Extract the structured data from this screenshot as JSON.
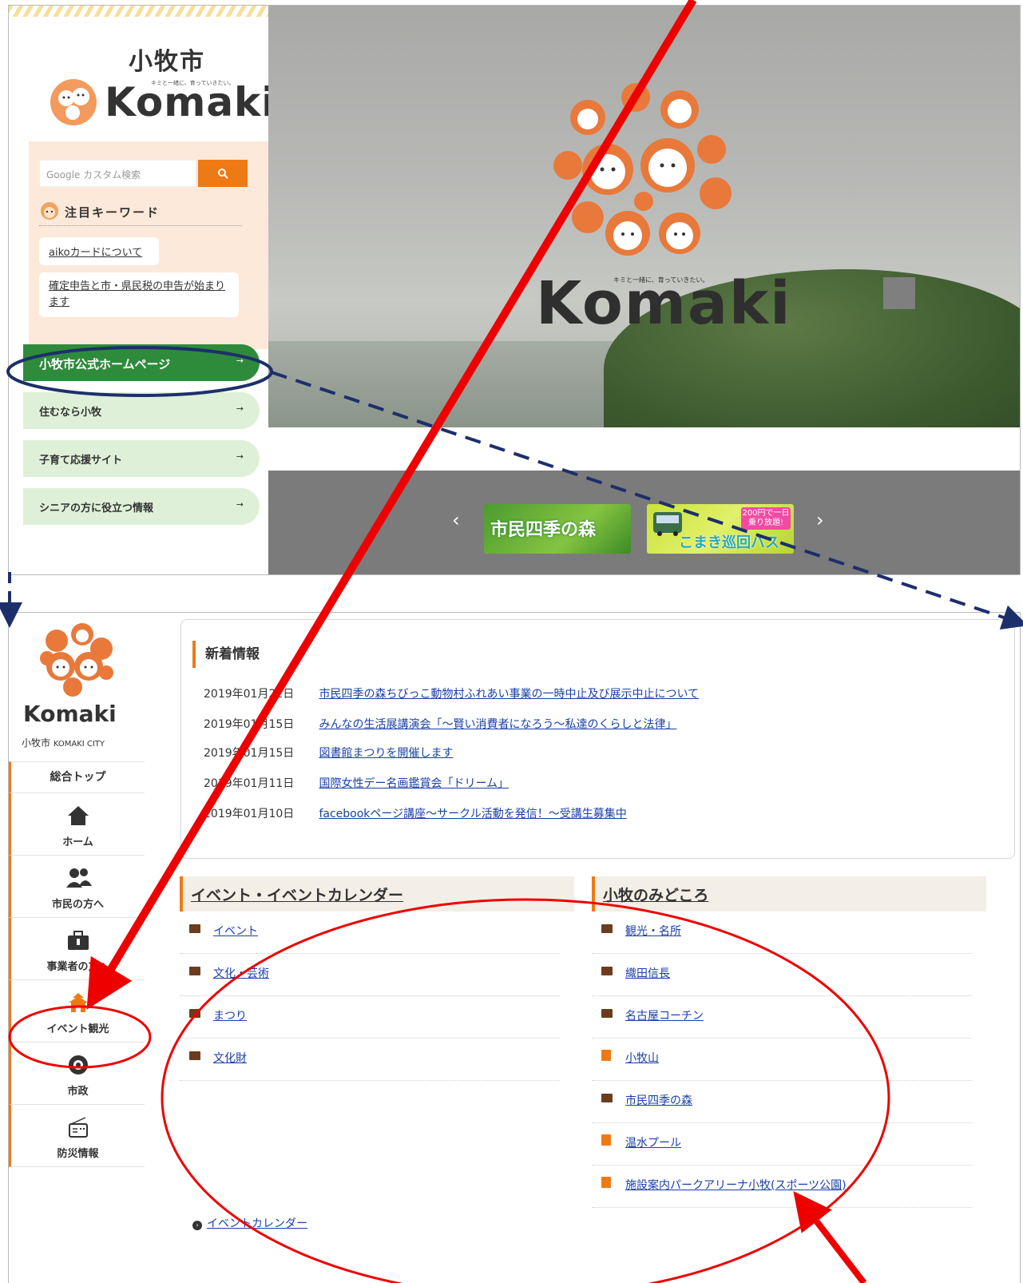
{
  "top": {
    "logo": {
      "city": "小牧市",
      "word": "Komaki",
      "tagline": "キミと一緒に、育っていきたい。"
    },
    "search": {
      "placeholder": "Google カスタム検索",
      "button_icon": "search-icon"
    },
    "keywords": {
      "title": "注目キーワード",
      "items": [
        "aikoカードについて",
        "確定申告と市・県民税の申告が始まります"
      ]
    },
    "nav": [
      {
        "label": "小牧市公式ホームページ",
        "arrow": "→"
      },
      {
        "label": "住むなら小牧",
        "arrow": "→"
      },
      {
        "label": "子育て応援サイト",
        "arrow": "→"
      },
      {
        "label": "シニアの方に役立つ情報",
        "arrow": "→"
      }
    ],
    "hero": {
      "word": "Komaki",
      "tagline": "キミと一緒に、育っていきたい。"
    },
    "carousel": {
      "prev": "‹",
      "next": "›",
      "banners": [
        {
          "text": "市民四季の森"
        },
        {
          "text": "こまき巡回バス",
          "tag": "200円で一日乗り放題!"
        }
      ]
    }
  },
  "bottom": {
    "logo": {
      "word": "Komaki",
      "city": "小牧市",
      "city_en": "KOMAKI CITY"
    },
    "menu": {
      "top": "総合トップ",
      "items": [
        {
          "label": "ホーム",
          "icon": "home-icon",
          "glyph": "⌂"
        },
        {
          "label": "市民の方へ",
          "icon": "people-icon",
          "glyph": "👥"
        },
        {
          "label": "事業者の方へ",
          "icon": "briefcase-icon",
          "glyph": "💼"
        },
        {
          "label": "イベント観光",
          "icon": "castle-icon",
          "glyph": "🏯"
        },
        {
          "label": "市政",
          "icon": "city-emblem-icon",
          "glyph": "✿"
        },
        {
          "label": "防災情報",
          "icon": "radio-icon",
          "glyph": "📻"
        }
      ]
    },
    "news": {
      "title": "新着情報",
      "items": [
        {
          "date": "2019年01月22日",
          "title": "市民四季の森ちびっこ動物村ふれあい事業の一時中止及び展示中止について"
        },
        {
          "date": "2019年01月15日",
          "title": "みんなの生活展講演会「～賢い消費者になろう～私達のくらしと法律」"
        },
        {
          "date": "2019年01月15日",
          "title": "図書館まつりを開催します"
        },
        {
          "date": "2019年01月11日",
          "title": "国際女性デー名画鑑賞会「ドリーム」"
        },
        {
          "date": "2019年01月10日",
          "title": "facebookページ講座～サークル活動を発信！～受講生募集中"
        }
      ]
    },
    "events": {
      "title": "イベント・イベントカレンダー",
      "items": [
        {
          "label": "イベント",
          "icon": "folder"
        },
        {
          "label": "文化・芸術",
          "icon": "folder"
        },
        {
          "label": "まつり",
          "icon": "folder"
        },
        {
          "label": "文化財",
          "icon": "folder"
        }
      ],
      "calendar_link": "イベントカレンダー"
    },
    "sights": {
      "title": "小牧のみどころ",
      "items": [
        {
          "label": "観光・名所",
          "icon": "folder"
        },
        {
          "label": "織田信長",
          "icon": "folder"
        },
        {
          "label": "名古屋コーチン",
          "icon": "folder"
        },
        {
          "label": "小牧山",
          "icon": "doc"
        },
        {
          "label": "市民四季の森",
          "icon": "folder"
        },
        {
          "label": "温水プール",
          "icon": "doc"
        },
        {
          "label": "施設案内パークアリーナ小牧(スポーツ公園)",
          "icon": "doc"
        }
      ]
    }
  },
  "annotation_colors": {
    "arrow": "#ee0000",
    "dashed": "#1d2f6b"
  }
}
